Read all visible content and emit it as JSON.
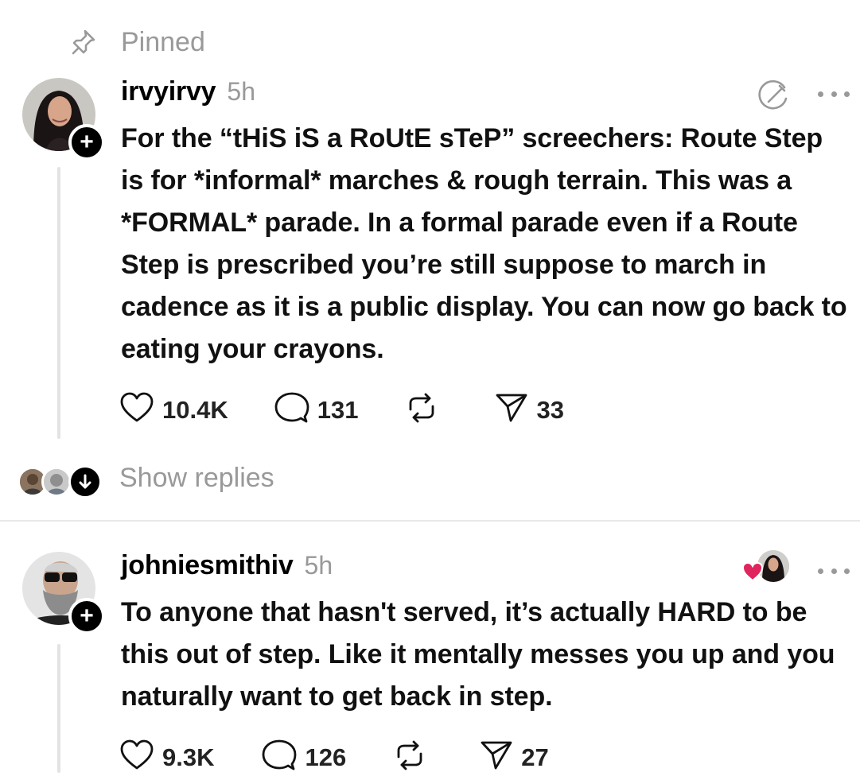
{
  "pinned": {
    "label": "Pinned"
  },
  "posts": [
    {
      "username": "irvyirvy",
      "time": "5h",
      "text": "For the “tHiS iS a RoUtE sTeP” screechers: Route Step is for *informal* marches & rough terrain. This was a *FORMAL* parade. In a formal parade even if a Route Step is prescribed you’re still suppose to march in cadence as it is a public display. You can now go back to eating your crayons.",
      "likes": "10.4K",
      "replies": "131",
      "shares": "33"
    },
    {
      "username": "johniesmithiv",
      "time": "5h",
      "text": "To anyone that hasn't served, it’s actually HARD to be this out of step. Like it mentally messes you up and you naturally want to get back in step.",
      "likes": "9.3K",
      "replies": "126",
      "shares": "27"
    }
  ],
  "show_replies": {
    "label": "Show replies"
  },
  "icons": {
    "pin": "pin-icon",
    "follow": "plus-icon",
    "edit": "edit-icon",
    "more": "more-icon",
    "like": "heart-icon",
    "reply": "comment-icon",
    "repost": "repost-icon",
    "share": "send-icon",
    "expand": "arrow-down-icon",
    "liked_by_author": "red-heart-icon"
  },
  "colors": {
    "muted": "#999999",
    "text": "#111111",
    "heart": "#e0245e",
    "divider": "#e8e8e8"
  }
}
